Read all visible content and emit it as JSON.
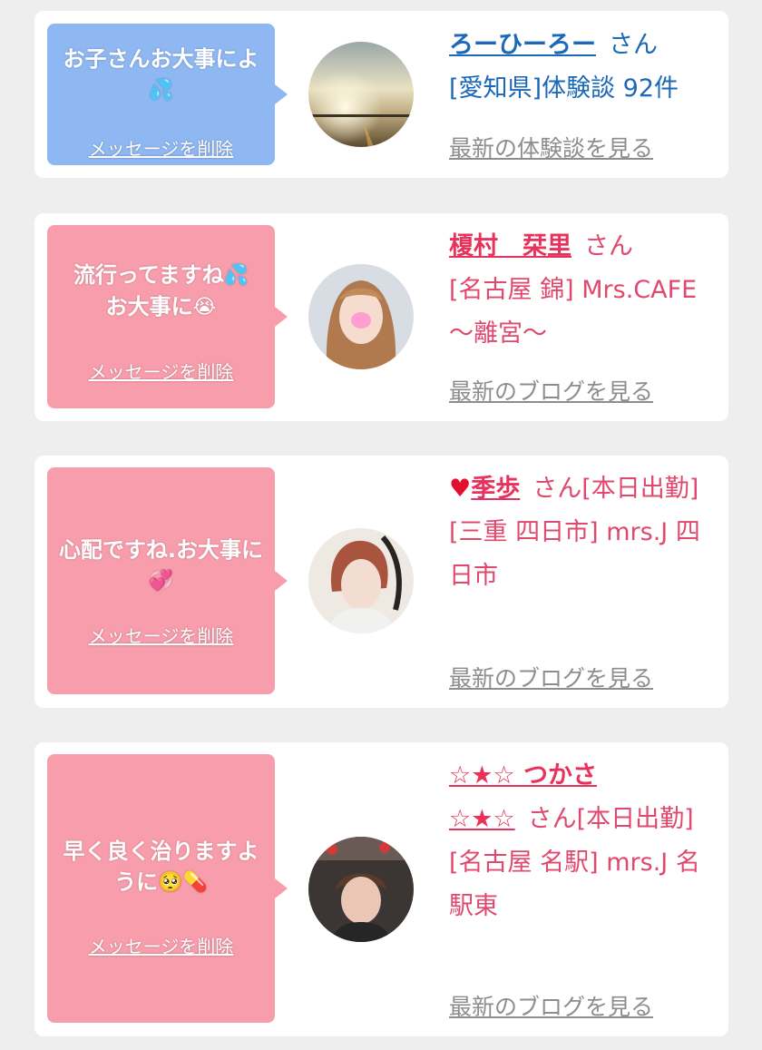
{
  "cards": [
    {
      "message": "お子さんお大事によ",
      "delete_label": "メッセージを削除",
      "name": "ろーひーろー",
      "san": "さん",
      "shop": "[愛知県]体験談 92件",
      "more_label": "最新の体験談を見る",
      "bubble_color": "#8fb7f2",
      "name_color": "#1b67b8"
    },
    {
      "message_line1": "流行ってますね",
      "message_line2": "お大事に",
      "delete_label": "メッセージを削除",
      "name": "榎村　栞里",
      "san": "さん",
      "shop": "[名古屋 錦] Mrs.CAFE ～離宮～",
      "more_label": "最新のブログを見る",
      "bubble_color": "#f89dab",
      "name_color": "#e8325b"
    },
    {
      "message": "心配ですね.お大事に",
      "delete_label": "メッセージを削除",
      "name_prefix": "♥",
      "name": "季歩",
      "san": "さん[本日出勤]",
      "shop": "[三重 四日市] mrs.J 四日市",
      "more_label": "最新のブログを見る",
      "bubble_color": "#f89dab",
      "name_color": "#e8325b"
    },
    {
      "message": "早く良く治りますように",
      "delete_label": "メッセージを削除",
      "name_line1": "☆★☆ つかさ",
      "name_line2": "☆★☆",
      "san": "さん[本日出勤]",
      "shop": "[名古屋 名駅] mrs.J 名駅東",
      "more_label": "最新のブログを見る",
      "bubble_color": "#f89dab",
      "name_color": "#e8325b"
    }
  ]
}
